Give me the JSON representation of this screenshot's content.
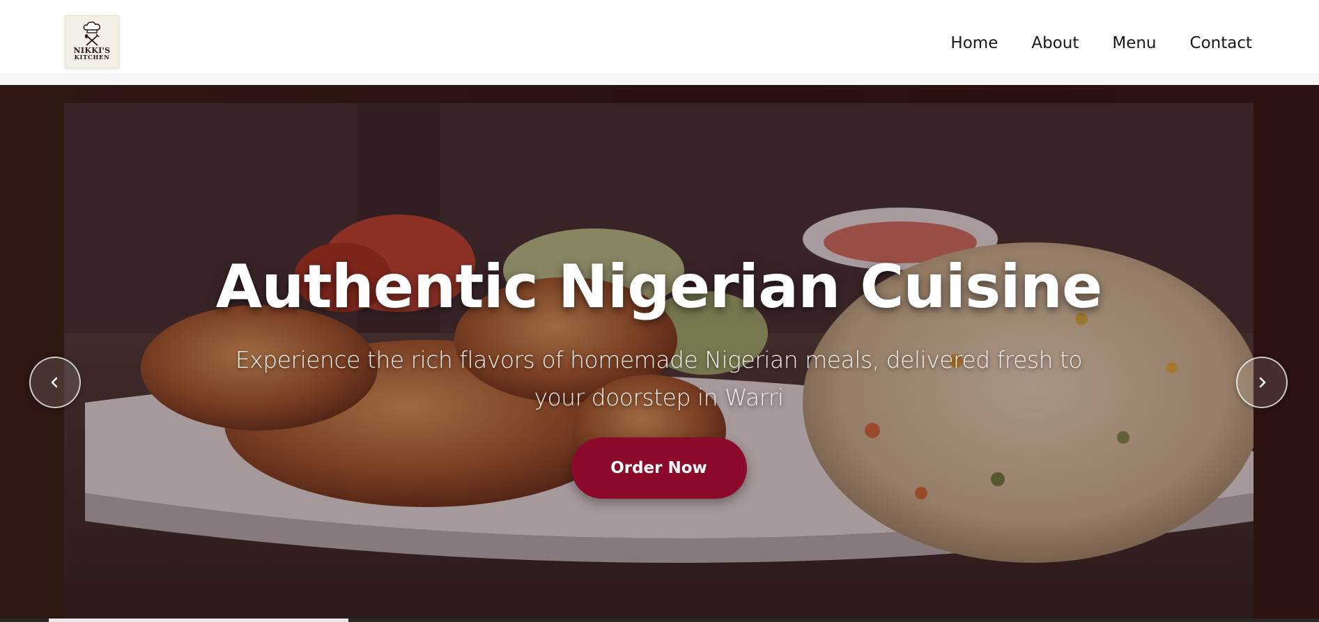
{
  "brand": {
    "logo_line1": "NIKKI'S",
    "logo_line2": "KITCHEN"
  },
  "nav": {
    "items": [
      {
        "label": "Home"
      },
      {
        "label": "About"
      },
      {
        "label": "Menu"
      },
      {
        "label": "Contact"
      }
    ]
  },
  "hero": {
    "title": "Authentic Nigerian Cuisine",
    "subtitle": "Experience the rich flavors of homemade Nigerian meals, delivered fresh to your doorstep in Warri",
    "cta_label": "Order Now",
    "prev_icon": "chevron-left-icon",
    "next_icon": "chevron-right-icon"
  },
  "colors": {
    "accent": "#8b0a2a",
    "hero_background": "#2c1410",
    "nav_text": "#1c1512"
  }
}
